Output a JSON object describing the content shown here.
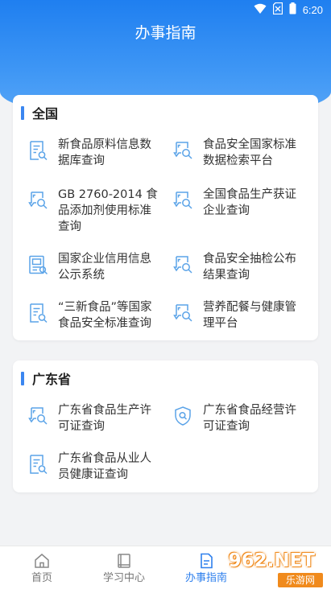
{
  "status": {
    "time": "6:20"
  },
  "header": {
    "title": "办事指南"
  },
  "national": {
    "title": "全国",
    "items": [
      {
        "label": "新食品原料信息数据库查询",
        "icon": "document-search-icon"
      },
      {
        "label": "食品安全国家标准数据检索平台",
        "icon": "chat-search-icon"
      },
      {
        "label": "GB 2760-2014 食品添加剂使用标准查询",
        "icon": "chat-search-icon"
      },
      {
        "label": "全国食品生产获证企业查询",
        "icon": "chat-search-icon"
      },
      {
        "label": "国家企业信用信息公示系统",
        "icon": "id-card-icon"
      },
      {
        "label": "食品安全抽检公布结果查询",
        "icon": "chat-search-icon"
      },
      {
        "label": "“三新食品”等国家食品安全标准查询",
        "icon": "document-search-icon"
      },
      {
        "label": "营养配餐与健康管理平台",
        "icon": "chat-search-icon"
      }
    ]
  },
  "guangdong": {
    "title": "广东省",
    "items": [
      {
        "label": "广东省食品生产许可证查询",
        "icon": "chat-search-icon"
      },
      {
        "label": "广东省食品经营许可证查询",
        "icon": "shield-search-icon"
      },
      {
        "label": "广东省食品从业人员健康证查询",
        "icon": "document-search-icon"
      }
    ]
  },
  "tabs": [
    {
      "label": "首页",
      "icon": "home-icon",
      "active": false
    },
    {
      "label": "学习中心",
      "icon": "book-icon",
      "active": false
    },
    {
      "label": "办事指南",
      "icon": "guide-icon",
      "active": true
    }
  ],
  "watermark": {
    "text": "962.NET",
    "sub": "乐游网"
  },
  "colors": {
    "primary": "#2f80ed",
    "icon": "#5aa3e8",
    "background": "#f2f3f5"
  }
}
